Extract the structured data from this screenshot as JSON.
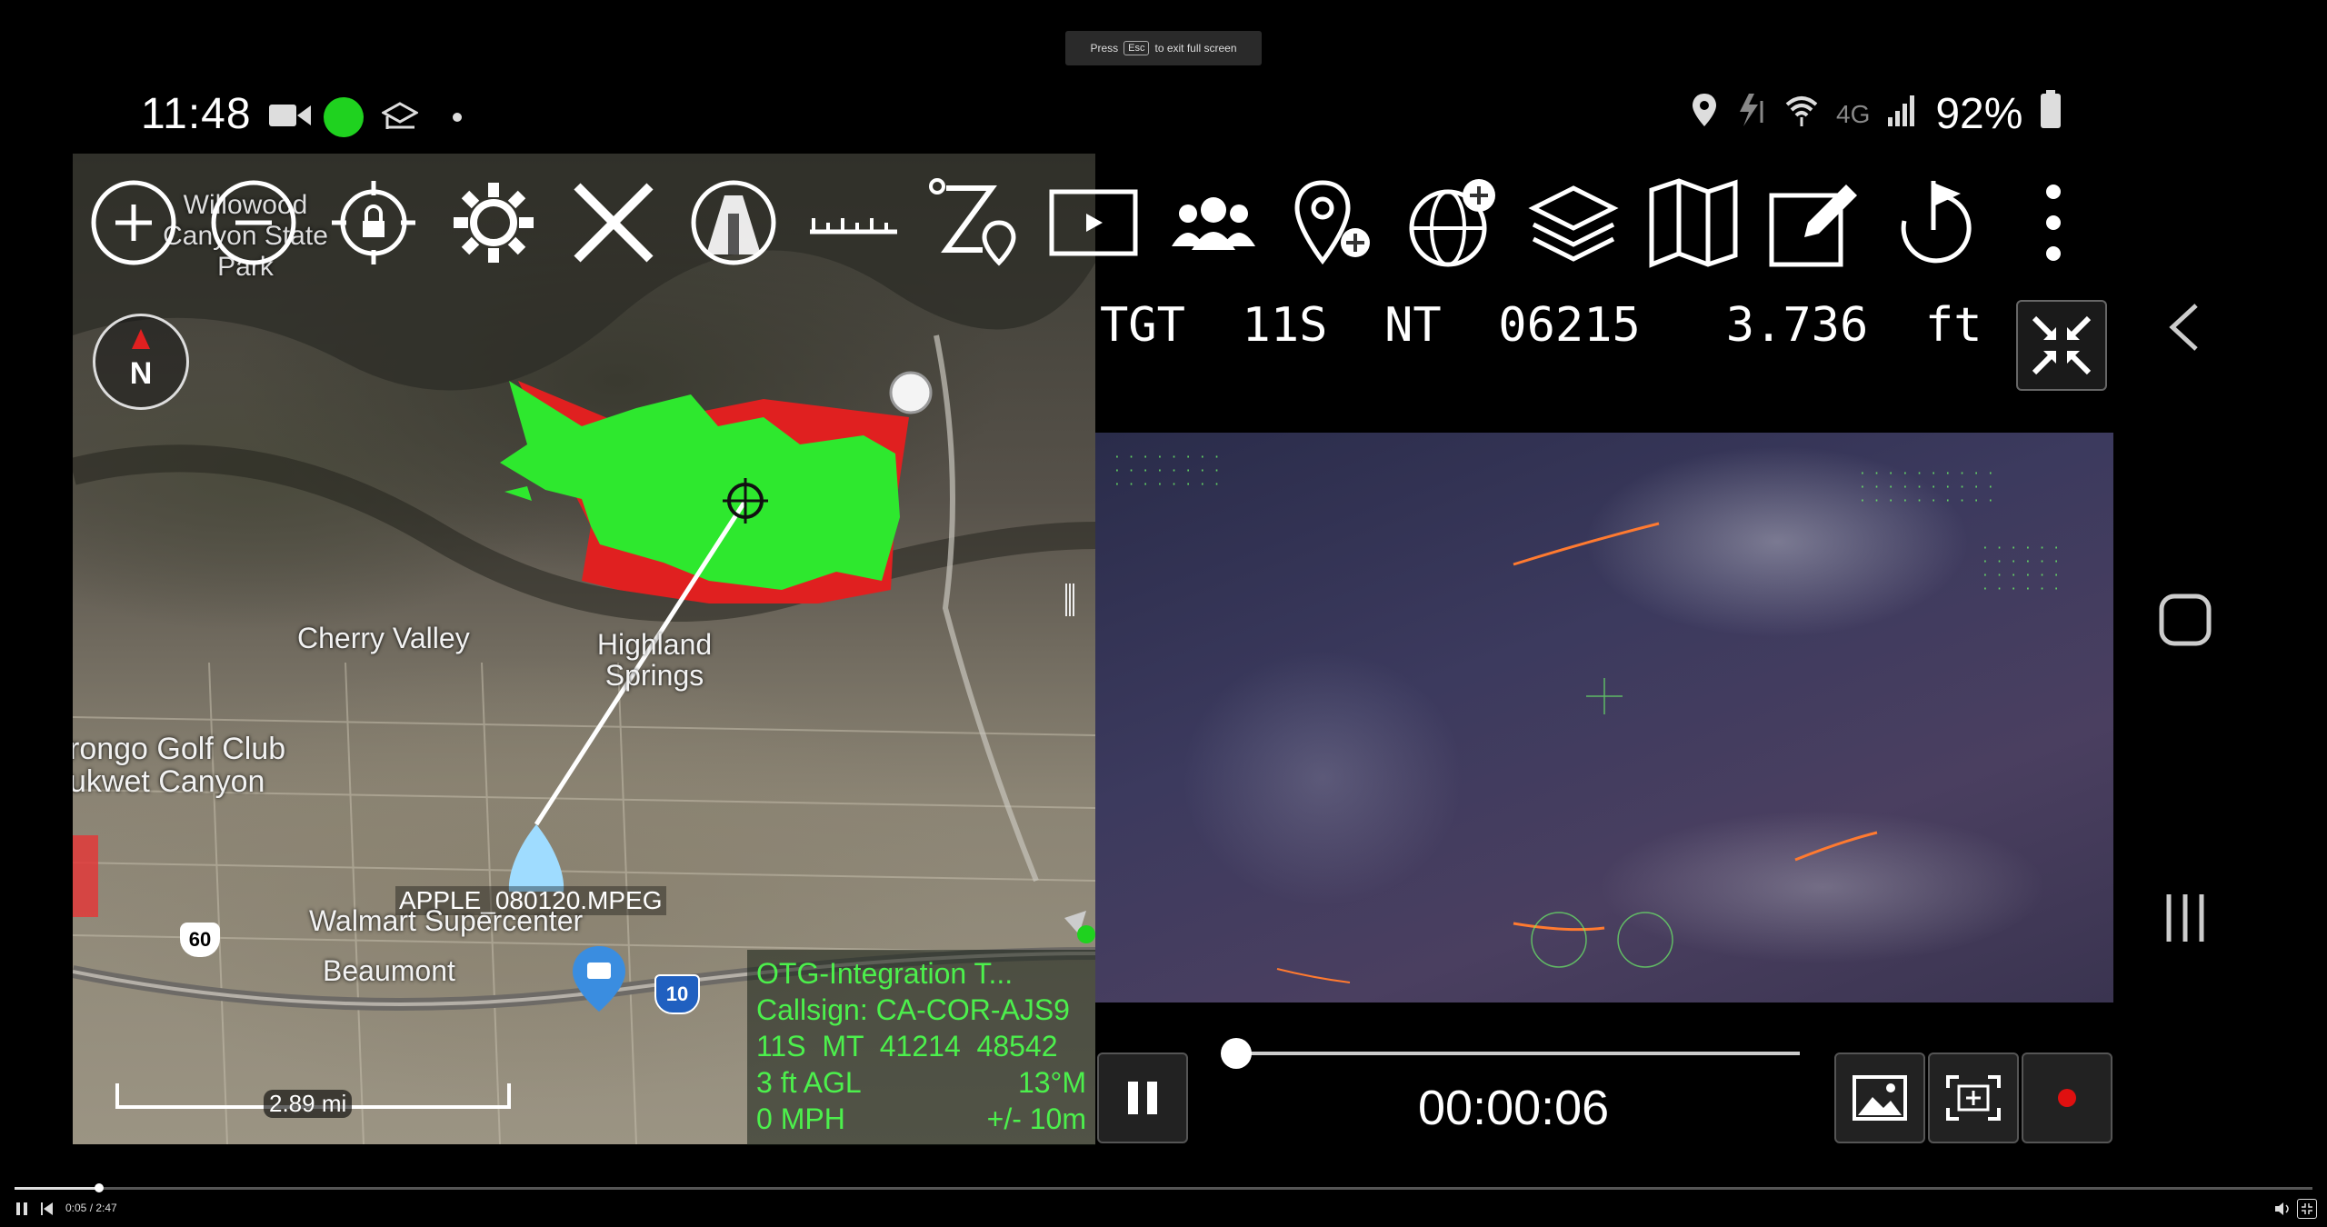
{
  "fullscreen_hint": {
    "prefix": "Press",
    "key": "Esc",
    "suffix": "to exit full screen"
  },
  "status_bar": {
    "time": "11:48",
    "network": "4G",
    "battery": "92%"
  },
  "map": {
    "labels": {
      "park": "Willowood Canyon State Park",
      "cherry_valley": "Cherry Valley",
      "highland_springs": "Highland Springs",
      "golf_club": "rongo Golf Club",
      "canyon": "ukwet Canyon",
      "walmart": "Walmart Supercenter",
      "beaumont": "Beaumont",
      "video_marker": "APPLE_080120.MPEG",
      "route_60": "60",
      "route_10": "10"
    },
    "compass": "N",
    "scale": "2.89 mi",
    "fire_colors": {
      "perimeter_green": "#2ee82e",
      "hotspot_red": "#e02020"
    }
  },
  "toolbar": {
    "icons": [
      "zoom-in-icon",
      "zoom-out-icon",
      "lock-location-icon",
      "settings-gear-icon",
      "close-x-icon",
      "aircraft-compass-icon",
      "ruler-icon",
      "route-icon",
      "video-play-icon",
      "contacts-group-icon",
      "add-location-icon",
      "add-globe-icon",
      "layers-icon",
      "map-icon",
      "edit-icon",
      "flag-refresh-icon",
      "more-vertical-icon"
    ]
  },
  "info_box": {
    "title": "OTG-Integration T...",
    "callsign": "Callsign: CA-COR-AJS9",
    "grid": "11S  MT  41214  48542",
    "altitude": "3 ft AGL",
    "heading": "13°M",
    "speed": "0 MPH",
    "accuracy": "+/- 10m"
  },
  "video": {
    "target": "TGT  11S  NT  06215   3.736  ft",
    "elapsed": "00:00:06",
    "progress": 0.0
  },
  "player": {
    "time": "0:05 / 2:47",
    "progress_fraction": 0.03
  },
  "colors": {
    "hud_green": "#4cf04c",
    "accent_red": "#e01010"
  }
}
